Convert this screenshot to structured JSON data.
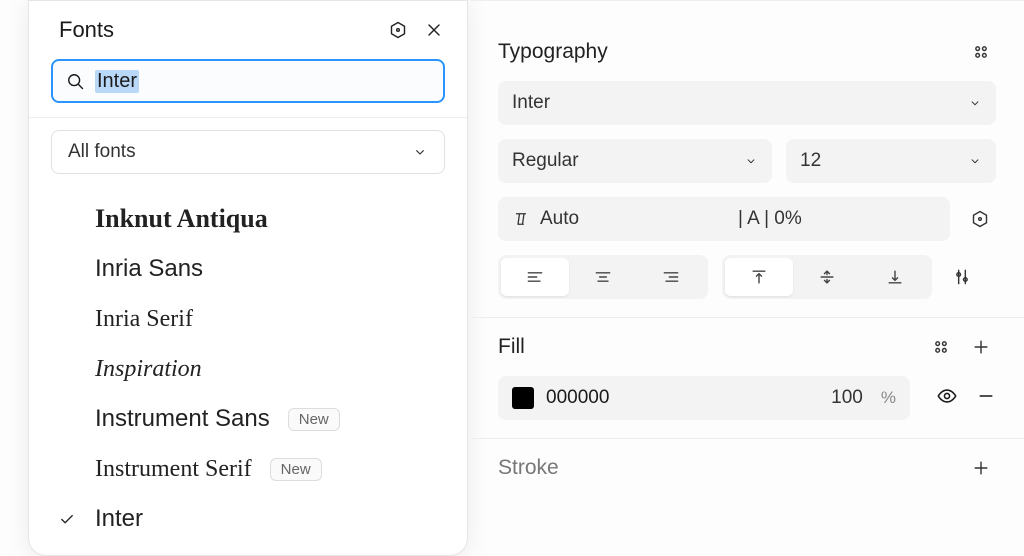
{
  "fontPicker": {
    "title": "Fonts",
    "search": "Inter",
    "filter": "All fonts",
    "items": [
      {
        "name": "Inknut Antiqua",
        "cls": "ff-inknut",
        "badge": null,
        "selected": false
      },
      {
        "name": "Inria Sans",
        "cls": "ff-inria-sans",
        "badge": null,
        "selected": false
      },
      {
        "name": "Inria Serif",
        "cls": "ff-inria-serif",
        "badge": null,
        "selected": false
      },
      {
        "name": "Inspiration",
        "cls": "ff-inspiration",
        "badge": null,
        "selected": false
      },
      {
        "name": "Instrument Sans",
        "cls": "ff-instrument-sans",
        "badge": "New",
        "selected": false
      },
      {
        "name": "Instrument Serif",
        "cls": "ff-instrument-serif",
        "badge": "New",
        "selected": false
      },
      {
        "name": "Inter",
        "cls": "ff-inter",
        "badge": null,
        "selected": true
      }
    ]
  },
  "typography": {
    "title": "Typography",
    "fontFamily": "Inter",
    "weight": "Regular",
    "size": "12",
    "lineHeight": "Auto",
    "letterSpacing": "| A | 0%"
  },
  "fill": {
    "title": "Fill",
    "hex": "000000",
    "opacity": "100",
    "opacityUnit": "%"
  },
  "stroke": {
    "title": "Stroke"
  }
}
